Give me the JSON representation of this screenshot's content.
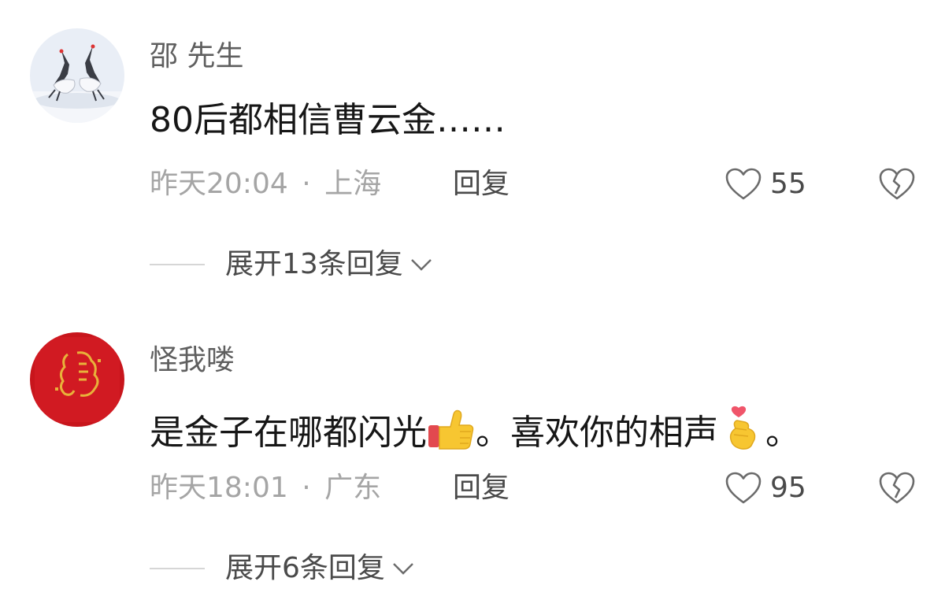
{
  "comments": [
    {
      "username": "邵 先生",
      "content": "80后都相信曹云金……",
      "time": "昨天20:04",
      "separator": "·",
      "location": "上海",
      "reply_label": "回复",
      "likes": "55",
      "expand_label": "展开13条回复",
      "avatar_icon": "red-crowned-cranes-avatar"
    },
    {
      "username": "怪我喽",
      "content_parts": [
        "是金子在哪都闪光",
        "。喜欢你的相声",
        "。"
      ],
      "content_emojis": [
        "thumbs-up-emoji",
        "finger-heart-emoji"
      ],
      "time": "昨天18:01",
      "separator": "·",
      "location": "广东",
      "reply_label": "回复",
      "likes": "95",
      "expand_label": "展开6条回复",
      "avatar_icon": "red-seal-avatar"
    }
  ],
  "colors": {
    "username": "#5f5f5f",
    "content": "#161616",
    "meta": "#a5a5a5",
    "action": "#4a4a4a",
    "divider": "#d6d6d6"
  }
}
